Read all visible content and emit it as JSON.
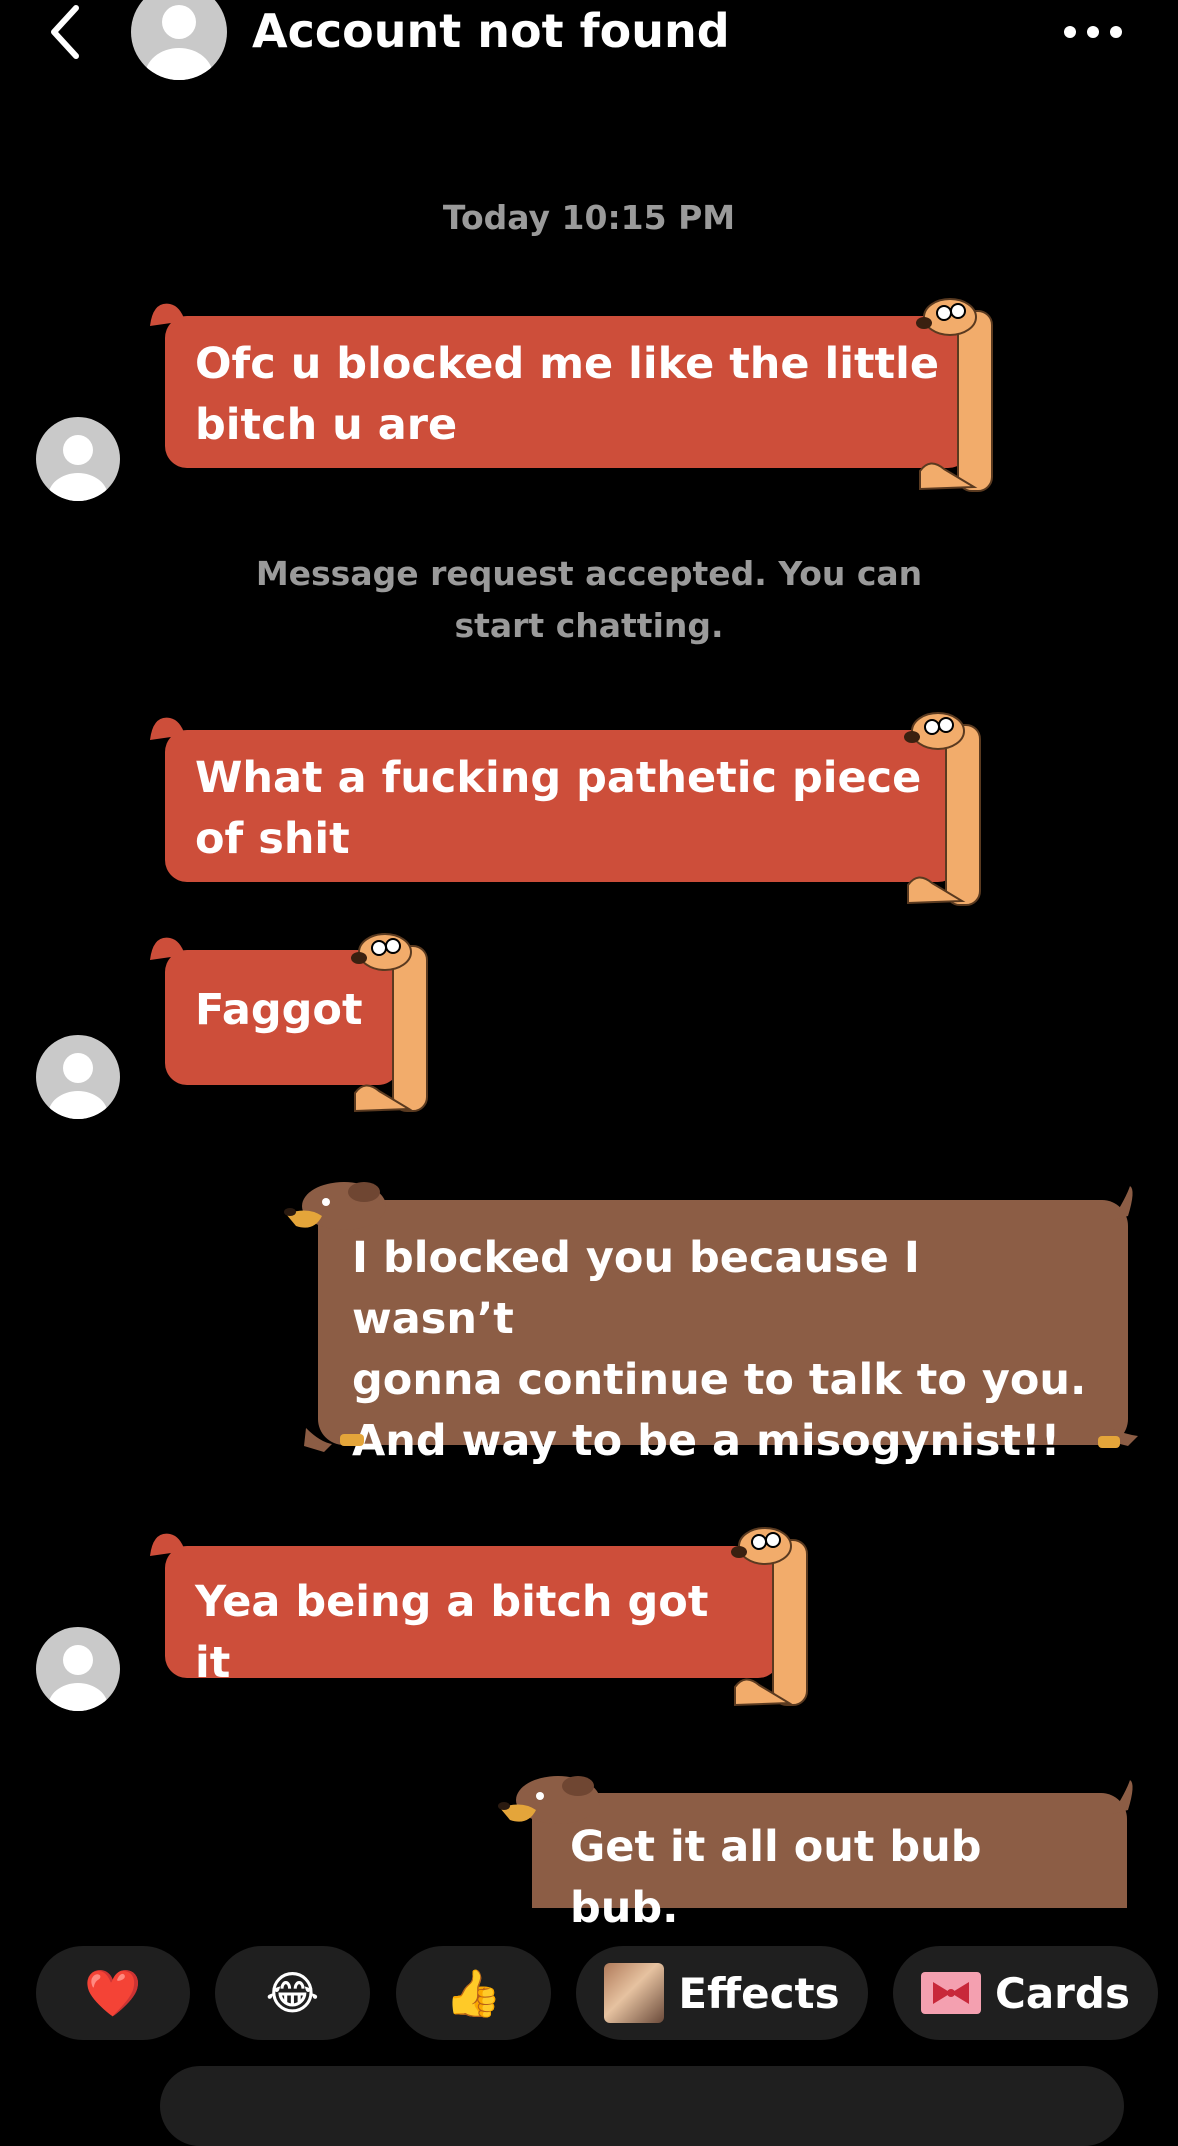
{
  "header": {
    "title": "Account not found",
    "back_icon": "chevron-left-icon",
    "more_icon": "more-horizontal-icon"
  },
  "timestamp": "Today 10:15 PM",
  "system_message": "Message request accepted. You can start chatting.",
  "messages": [
    {
      "from": "other",
      "text": "Ofc u blocked me like the little\nbitch u are"
    },
    {
      "from": "other",
      "text": "What a fucking pathetic piece\nof shit"
    },
    {
      "from": "other",
      "text": "Faggot"
    },
    {
      "from": "me",
      "text": "I blocked you because I wasn’t\ngonna continue to talk to you.\nAnd way to be a misogynist!!"
    },
    {
      "from": "other",
      "text": "Yea being a bitch got it"
    },
    {
      "from": "me",
      "text": "Get it all out bub bub."
    }
  ],
  "reactions": {
    "heart": "❤️",
    "laugh": "😂",
    "thumbs_up": "👍",
    "effects_label": "Effects",
    "cards_label": "Cards"
  },
  "colors": {
    "background": "#000000",
    "other_bubble": "#cd4e3a",
    "my_bubble": "#8c5d45",
    "meta_text": "#9a9a9a",
    "chip_bg": "#1f1f1f"
  }
}
